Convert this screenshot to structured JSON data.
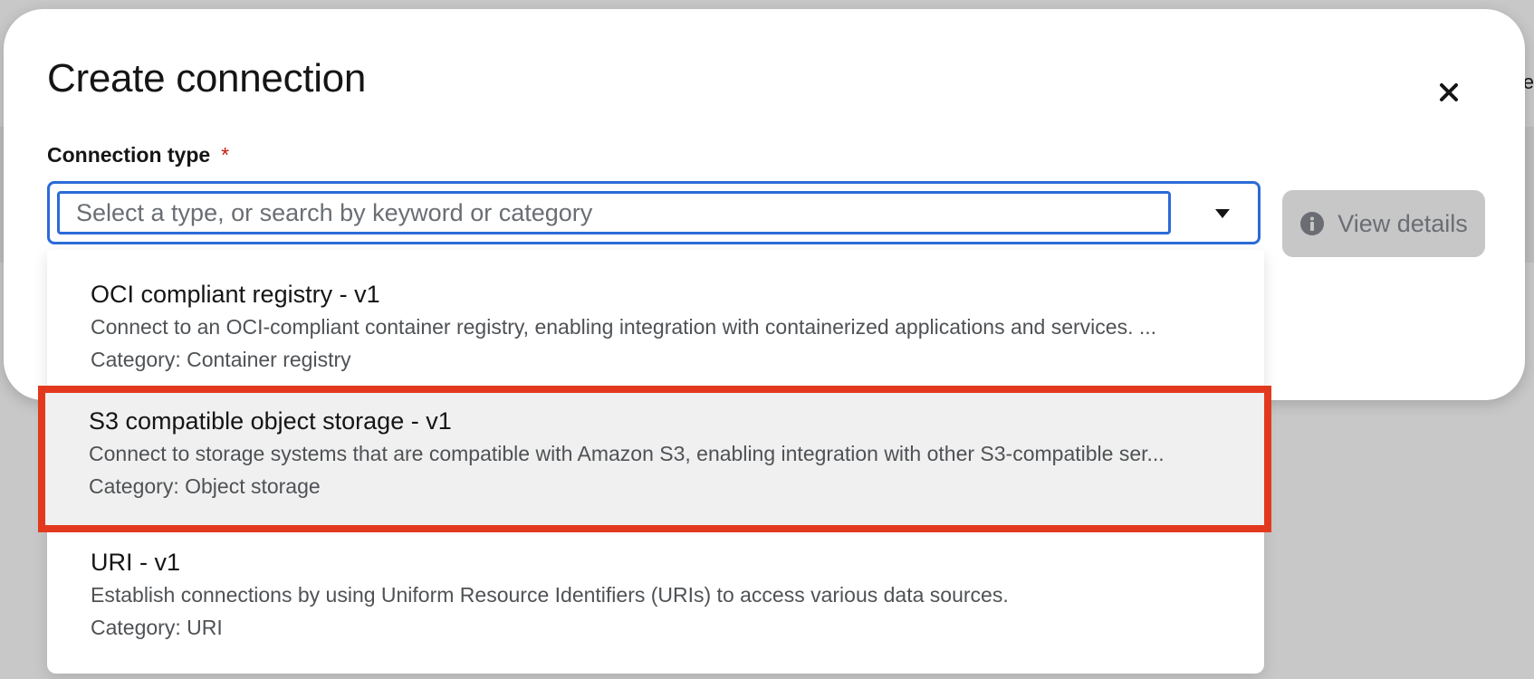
{
  "background": {
    "edge_text": "e"
  },
  "modal": {
    "title": "Create connection",
    "close_icon": "close-icon",
    "connection_type": {
      "label": "Connection type",
      "required_marker": "*",
      "search_placeholder": "Select a type, or search by keyword or category",
      "search_value": "",
      "toggle_icon": "caret-down-icon"
    },
    "view_details": {
      "label": "View details",
      "icon": "info-circle-icon",
      "disabled": true
    }
  },
  "dropdown": {
    "options": [
      {
        "title": "OCI compliant registry - v1",
        "description": "Connect to an OCI-compliant container registry, enabling integration with containerized applications and services. ...",
        "category": "Category: Container registry",
        "highlighted": false
      },
      {
        "title": "S3 compatible object storage - v1",
        "description": "Connect to storage systems that are compatible with Amazon S3, enabling integration with other S3-compatible ser...",
        "category": "Category: Object storage",
        "highlighted": true
      },
      {
        "title": "URI - v1",
        "description": "Establish connections by using Uniform Resource Identifiers (URIs) to access various data sources.",
        "category": "Category: URI",
        "highlighted": false
      }
    ]
  },
  "colors": {
    "focus_border": "#2b6bd8",
    "highlight_outline": "#e2391e",
    "required": "#c9190b",
    "disabled_button": "#c7c7c7"
  }
}
